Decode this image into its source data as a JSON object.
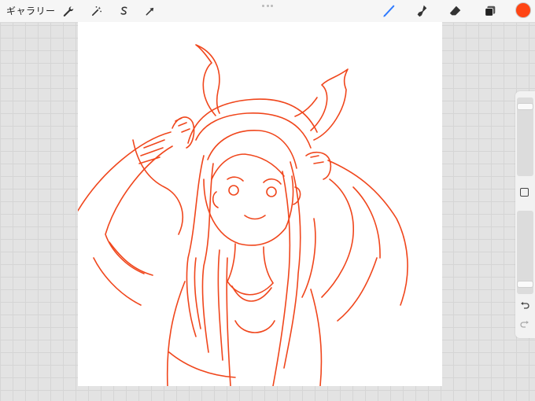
{
  "toolbar": {
    "gallery_label": "ギャラリー",
    "left_tools": [
      {
        "name": "actions",
        "icon": "wrench-icon"
      },
      {
        "name": "adjustments",
        "icon": "magic-wand-icon"
      },
      {
        "name": "selection",
        "icon": "selection-s-icon"
      },
      {
        "name": "transform",
        "icon": "arrow-cursor-icon"
      }
    ],
    "right_tools": [
      {
        "name": "brush",
        "icon": "brush-icon",
        "active": true
      },
      {
        "name": "smudge",
        "icon": "smudge-finger-icon",
        "active": false
      },
      {
        "name": "eraser",
        "icon": "eraser-icon",
        "active": false
      },
      {
        "name": "layers",
        "icon": "layers-icon",
        "active": false
      }
    ],
    "current_color": "#ff4514",
    "active_tool_color": "#2f7bff"
  },
  "canvas": {
    "background": "#ffffff",
    "stroke_color": "#f0461c",
    "content": "sketch-drawing"
  },
  "sidebar": {
    "brush_size_level": 0.92,
    "opacity_level": 0.08,
    "modify_icon": "square-icon",
    "undo_icon": "undo-arrow-icon",
    "redo_icon": "redo-arrow-icon",
    "redo_enabled": false
  }
}
